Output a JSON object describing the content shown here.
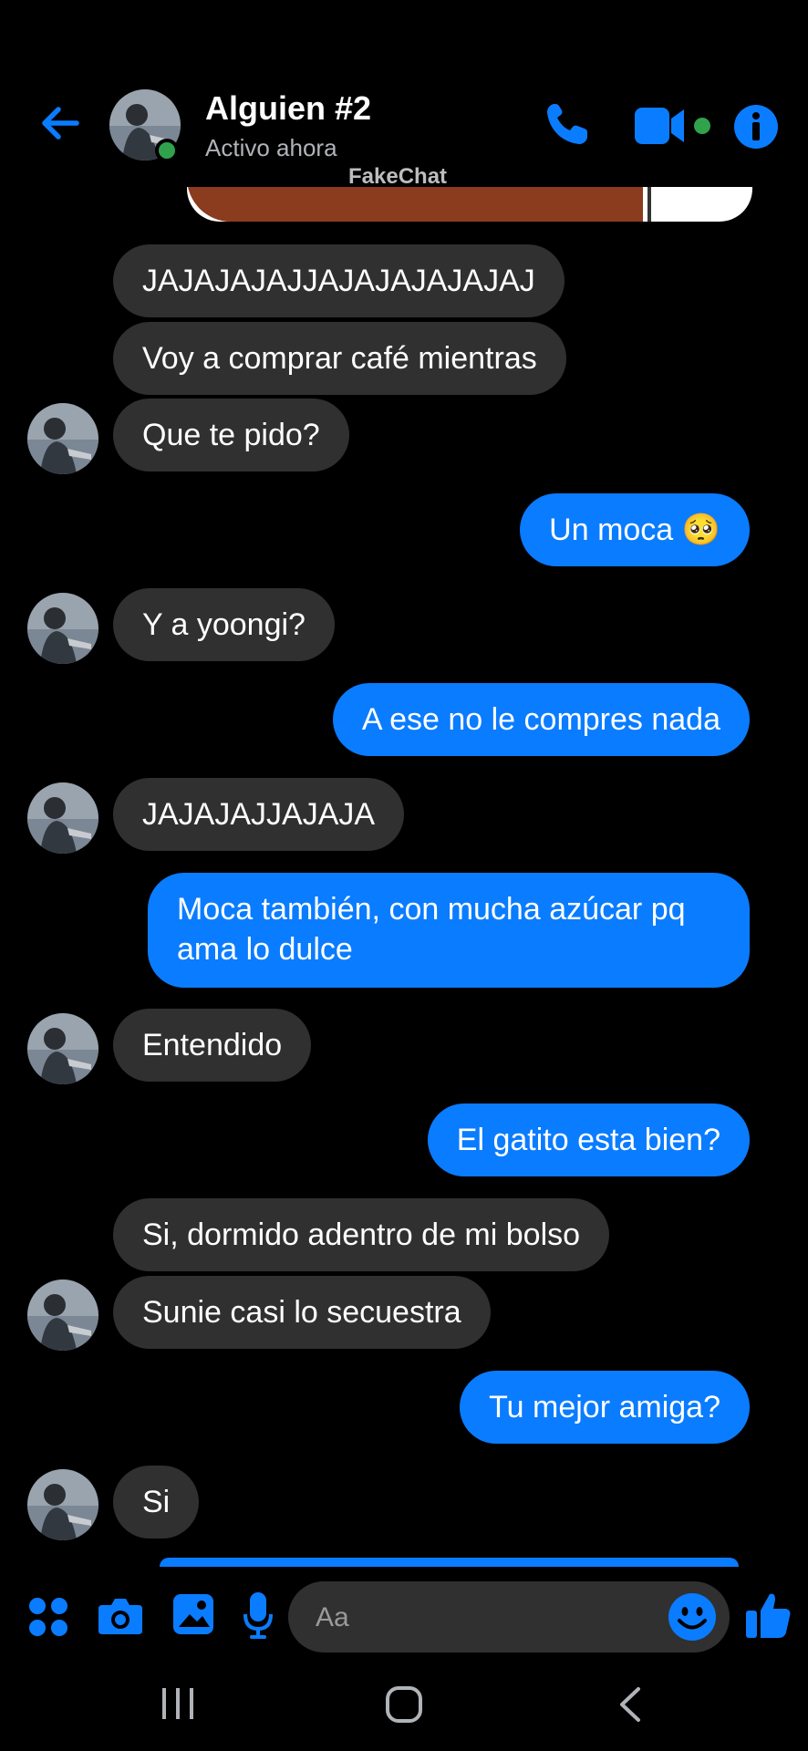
{
  "header": {
    "contact_name": "Alguien #2",
    "status": "Activo ahora",
    "watermark": "FakeChat"
  },
  "messages": [
    {
      "side": "in",
      "text": "JAJAJAJAJJAJAJAJAJAJAJ",
      "avatar": false
    },
    {
      "side": "in",
      "text": "Voy a comprar café mientras",
      "avatar": false
    },
    {
      "side": "in",
      "text": "Que te pido?",
      "avatar": true
    },
    {
      "side": "out",
      "text": "Un moca 🥺"
    },
    {
      "side": "in",
      "text": "Y a yoongi?",
      "avatar": true
    },
    {
      "side": "out",
      "text": "A ese no le compres nada"
    },
    {
      "side": "in",
      "text": "JAJAJAJJAJAJA",
      "avatar": true
    },
    {
      "side": "out",
      "text": "Moca también, con mucha azúcar pq ama lo dulce"
    },
    {
      "side": "in",
      "text": "Entendido",
      "avatar": true
    },
    {
      "side": "out",
      "text": "El gatito esta bien?"
    },
    {
      "side": "in",
      "text": "Si, dormido adentro de mi bolso",
      "avatar": false
    },
    {
      "side": "in",
      "text": "Sunie casi lo secuestra",
      "avatar": true
    },
    {
      "side": "out",
      "text": "Tu mejor amiga?"
    },
    {
      "side": "in",
      "text": "Si",
      "avatar": true
    }
  ],
  "composer": {
    "placeholder": "Aa"
  },
  "icons": {
    "back": "arrow-left-icon",
    "call": "phone-icon",
    "video": "video-camera-icon",
    "info": "info-icon",
    "menu": "four-dots-icon",
    "camera": "camera-icon",
    "gallery": "image-icon",
    "mic": "microphone-icon",
    "emoji": "smiley-icon",
    "like": "thumbs-up-icon",
    "nav_recent": "recent-apps-icon",
    "nav_home": "home-icon",
    "nav_back": "nav-back-icon"
  },
  "colors": {
    "accent": "#0a7cff",
    "incoming_bubble": "#303030",
    "online": "#31a24c",
    "background": "#000000"
  }
}
